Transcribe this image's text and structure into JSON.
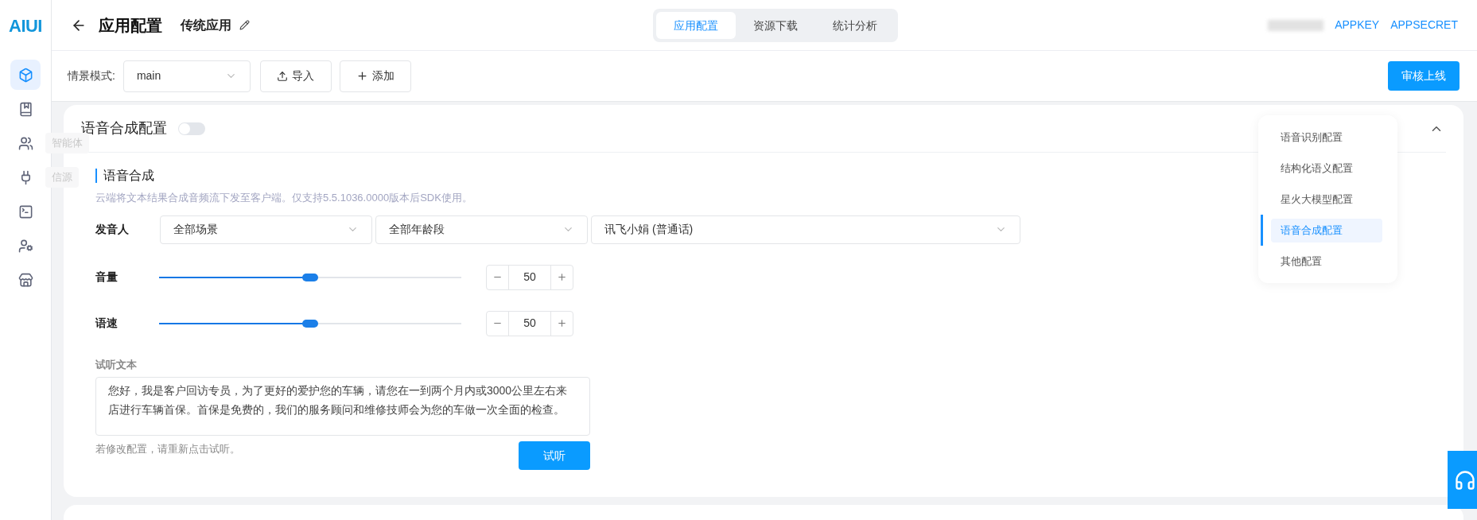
{
  "logo": "AIUI",
  "sidebar": {
    "items": [
      {
        "selected": true
      },
      {
        "selected": false
      },
      {
        "selected": false,
        "tooltip": "智能体"
      },
      {
        "selected": false,
        "tooltip": "信源"
      },
      {
        "selected": false
      },
      {
        "selected": false
      },
      {
        "selected": false
      }
    ]
  },
  "header": {
    "title": "应用配置",
    "app_name": "传统应用",
    "tabs": [
      {
        "label": "应用配置",
        "selected": true
      },
      {
        "label": "资源下载",
        "selected": false
      },
      {
        "label": "统计分析",
        "selected": false
      }
    ],
    "links": [
      "APPKEY",
      "APPSECRET"
    ]
  },
  "toolbar": {
    "scene_label": "情景模式:",
    "scene_value": "main",
    "import": "导入",
    "add": "添加",
    "publish": "审核上线"
  },
  "card": {
    "title": "语音合成配置",
    "enabled": false,
    "section": "语音合成",
    "description": "云端将文本结果合成音频流下发至客户端。仅支持5.5.1036.0000版本后SDK使用。",
    "speaker_label": "发音人",
    "speaker_selects": [
      "全部场景",
      "全部年龄段",
      "讯飞小娟 (普通话)"
    ],
    "sliders": [
      {
        "label": "音量",
        "level": 0.5,
        "value": "50"
      },
      {
        "label": "语速",
        "level": 0.5,
        "value": "50"
      }
    ],
    "preview_label": "试听文本",
    "preview_text": "您好，我是客户回访专员，为了更好的爱护您的车辆，请您在一到两个月内或3000公里左右来店进行车辆首保。首保是免费的，我们的服务顾问和维修技师会为您的车做一次全面的检查。",
    "hint": "若修改配置，请重新点击试听。",
    "listen": "试听"
  },
  "nav": [
    {
      "label": "语音识别配置",
      "selected": false
    },
    {
      "label": "结构化语义配置",
      "selected": false
    },
    {
      "label": "星火大模型配置",
      "selected": false
    },
    {
      "label": "语音合成配置",
      "selected": true
    },
    {
      "label": "其他配置",
      "selected": false
    }
  ]
}
